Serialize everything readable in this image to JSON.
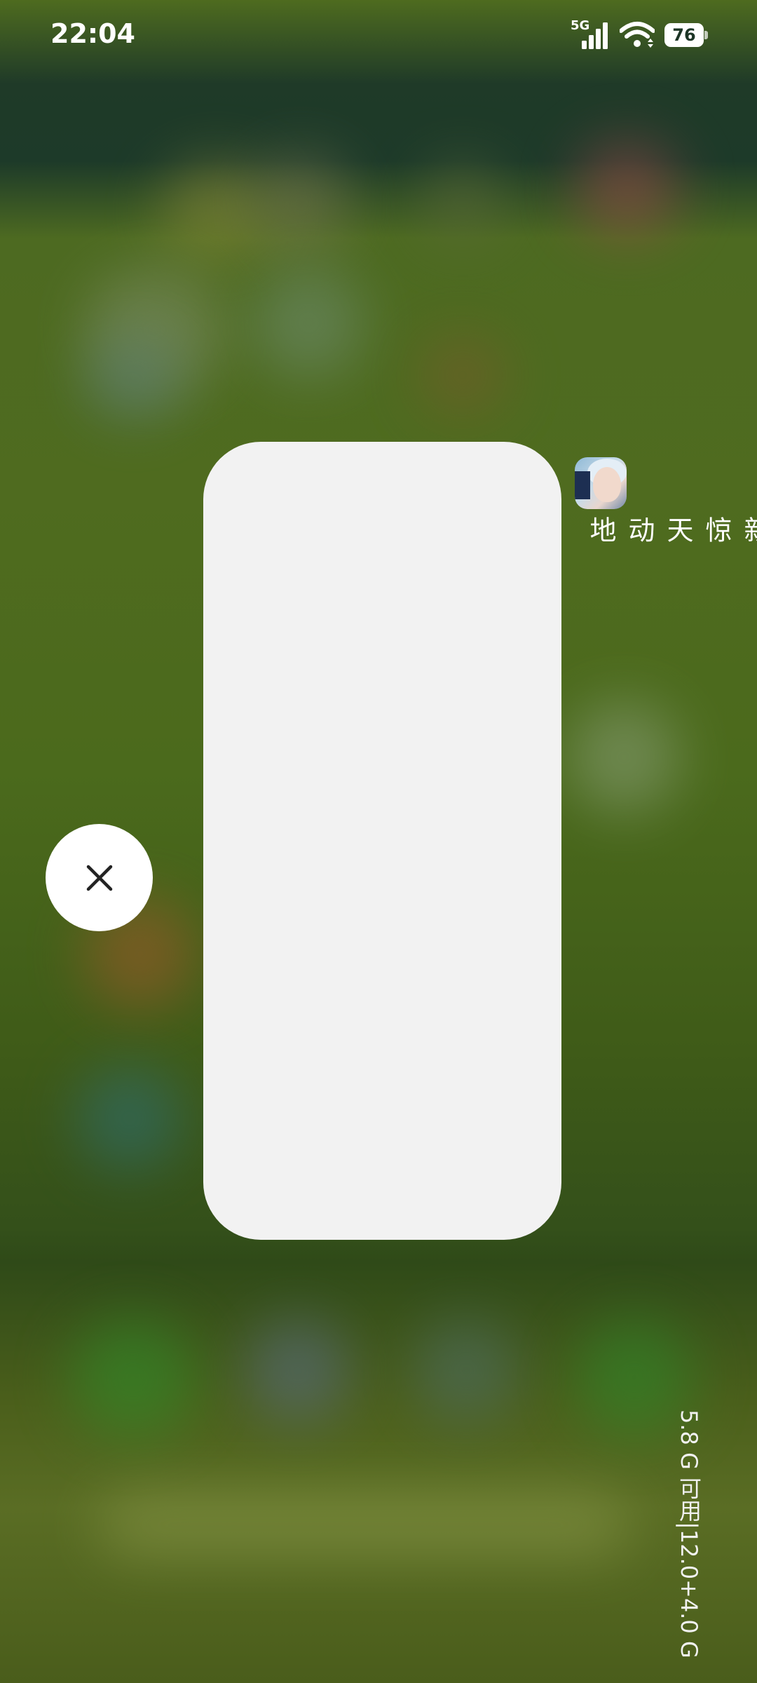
{
  "status_bar": {
    "time": "22:04",
    "network_type": "5G",
    "battery_level": "76",
    "icons": [
      "signal-icon",
      "wifi-icon",
      "battery-icon"
    ]
  },
  "recent_app": {
    "name": "新惊天动地",
    "icon": "app-icon-game"
  },
  "clear_all": {
    "icon": "close-icon"
  },
  "memory": {
    "text": "5.8 G 可用|12.0+4.0 G"
  },
  "colors": {
    "card_background": "#f2f2f2",
    "button_background": "#ffffff",
    "text_light": "#ffffff"
  }
}
